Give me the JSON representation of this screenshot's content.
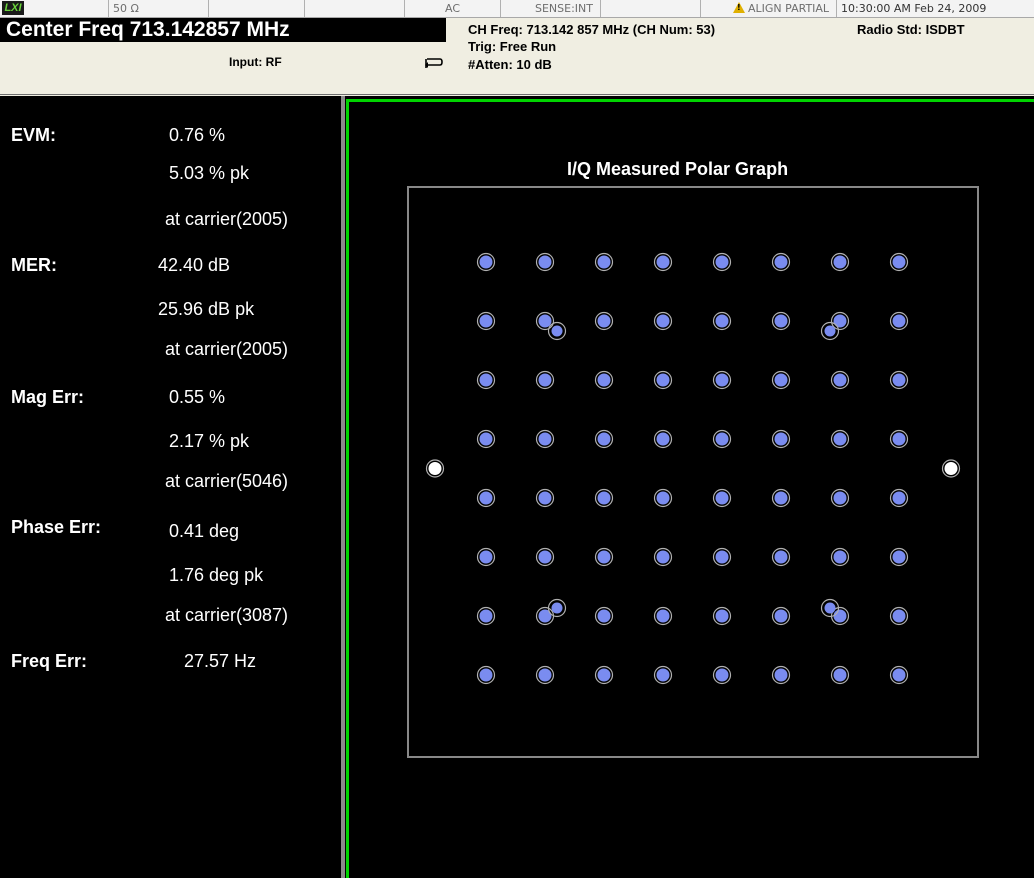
{
  "status_bar": {
    "logo": "LXI",
    "impedance": "50 Ω",
    "coupling": "AC",
    "sense": "SENSE:INT",
    "align": "ALIGN PARTIAL",
    "datetime": "10:30:00 AM Feb 24, 2009"
  },
  "settings": {
    "center_freq": "Center Freq  713.142857 MHz",
    "input": "Input: RF",
    "ch_freq": "CH Freq: 713.142 857 MHz (CH Num: 53)",
    "trig": "Trig: Free Run",
    "atten": "#Atten: 10 dB",
    "radio_std": "Radio Std: ISDBT"
  },
  "results": [
    {
      "label": "EVM:",
      "lines": [
        "0.76  %",
        "5.03  % pk",
        "at carrier(2005)"
      ]
    },
    {
      "label": "MER:",
      "lines": [
        "42.40  dB",
        "25.96  dB pk",
        "at carrier(2005)"
      ]
    },
    {
      "label": "Mag Err:",
      "lines": [
        "0.55  %",
        "2.17  % pk",
        "at carrier(5046)"
      ]
    },
    {
      "label": "Phase Err:",
      "lines": [
        "0.41  deg",
        "1.76  deg pk",
        "at carrier(3087)"
      ]
    },
    {
      "label": "Freq Err:",
      "lines": [
        "27.57 Hz"
      ]
    }
  ],
  "graph": {
    "title": "I/Q Measured Polar Graph",
    "grid_size": 8,
    "point_color": "#7a8cf0",
    "ring_color": "#b0b0b0",
    "pilot_color": "#ffffff",
    "pilot_points": [
      [
        -1.2,
        0
      ],
      [
        1.2,
        0
      ]
    ],
    "offset_markers": [
      [
        2,
        1
      ],
      [
        6,
        1
      ],
      [
        2,
        6
      ],
      [
        6,
        6
      ]
    ]
  }
}
